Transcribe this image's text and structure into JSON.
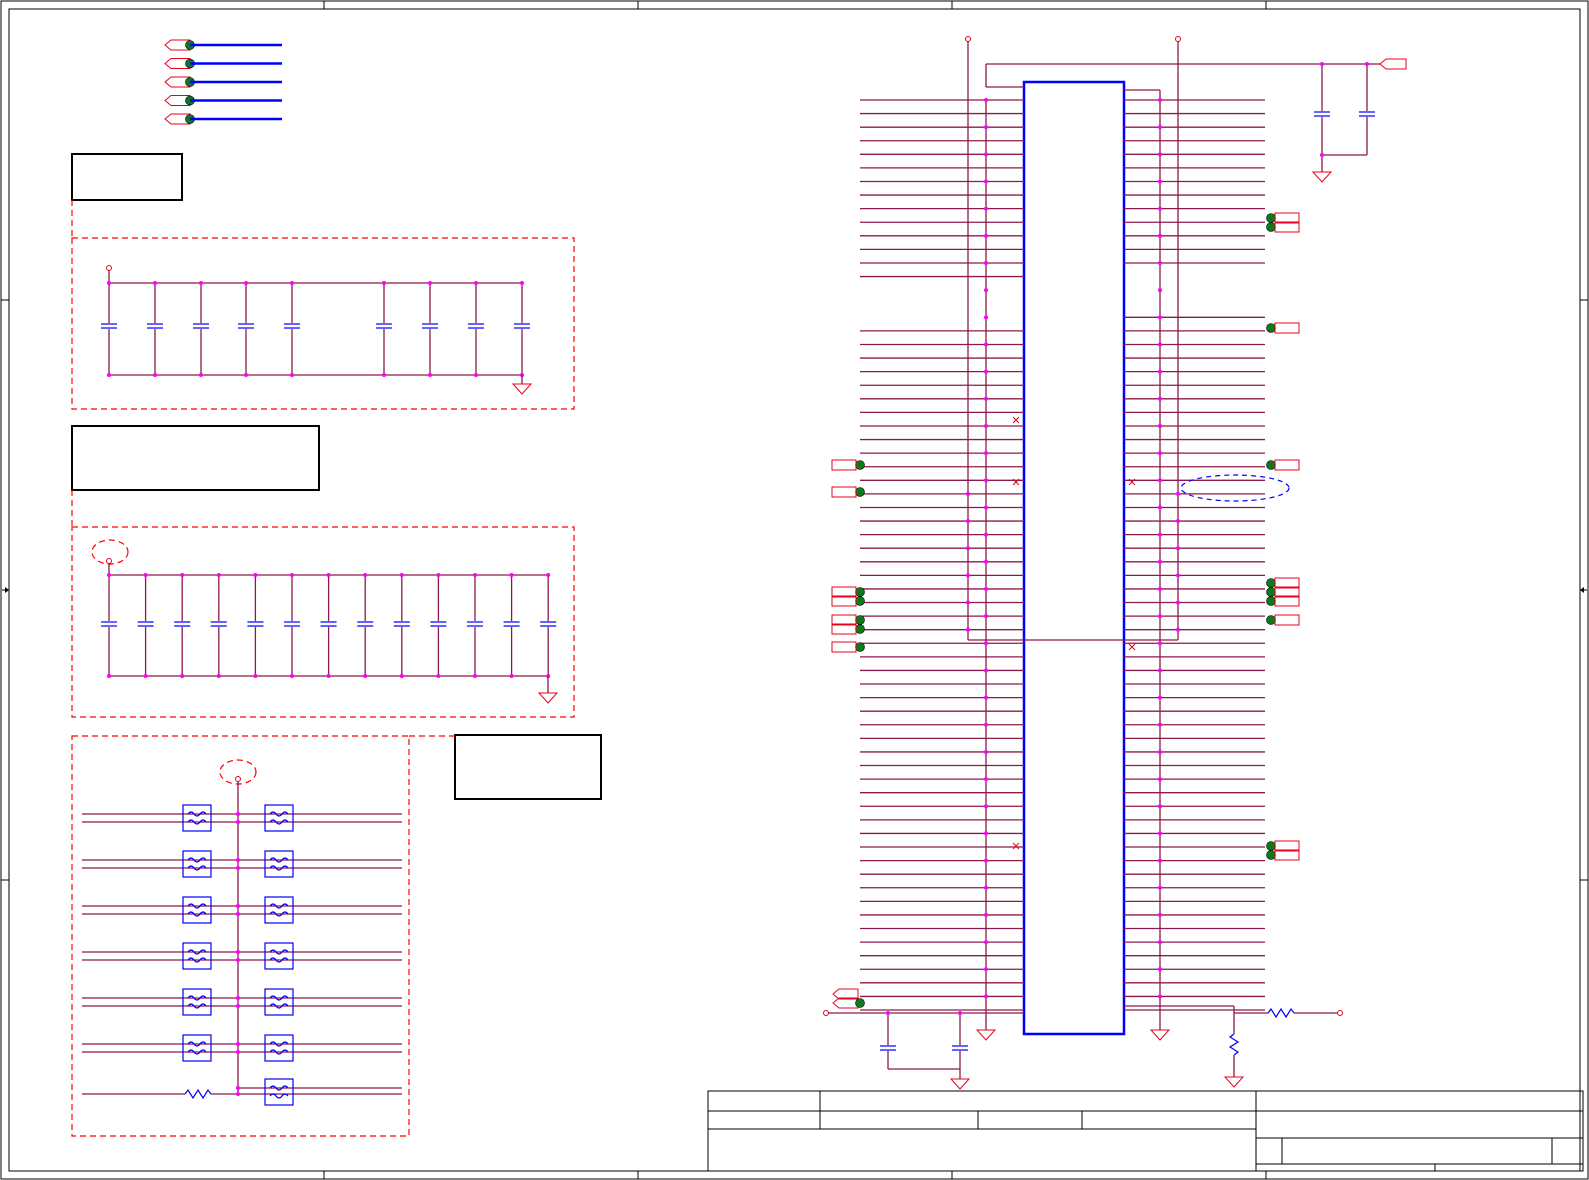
{
  "palette": {
    "wire": "#8b1a4a",
    "bus": "#0000ff",
    "junction": "#ff00ff",
    "connector": "#e8001c",
    "pin_dot": "#0b7a1a",
    "region_outline": "#ff0000"
  },
  "frame": {
    "row_marker_icon": "arrow-right-icon",
    "row_marker_icon_right": "arrow-left-icon"
  },
  "net_ports": {
    "count": 5,
    "icon": "hexagon-port-icon"
  },
  "decoupling_group_1": {
    "capacitor_count": 9,
    "icon": "capacitor-icon"
  },
  "decoupling_group_2": {
    "capacitor_count": 13,
    "icon": "capacitor-icon"
  },
  "filter_network": {
    "ferrite_count": 13,
    "resistor_count": 1,
    "icon": "ferrite-bead-icon"
  },
  "connector_block": {
    "outline_color": "#0000ff",
    "left_pin_count": 68,
    "right_pin_count": 68,
    "no_connect_icon": "x-mark-icon"
  },
  "title_block": {
    "icon": "title-block-grid"
  }
}
